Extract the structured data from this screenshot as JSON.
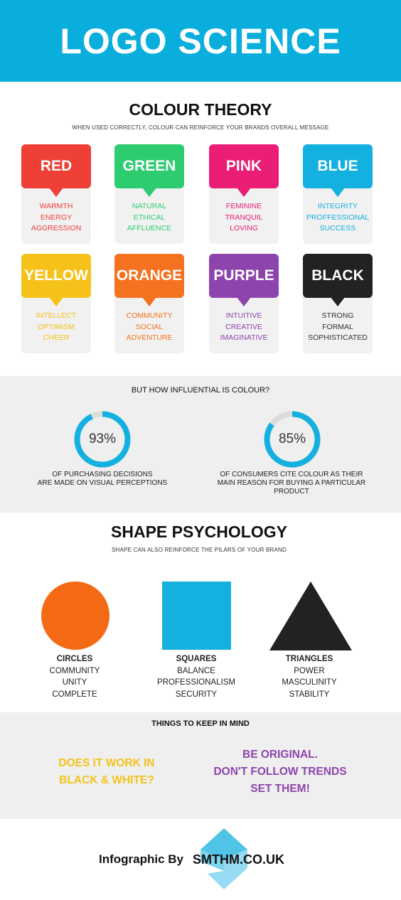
{
  "header": {
    "title": "LOGO SCIENCE"
  },
  "colour_theory": {
    "title": "COLOUR THEORY",
    "subtitle": "WHEN USED CORRECTLY, COLOUR CAN REINFORCE YOUR BRANDS OVERALL MESSAGE",
    "cards": [
      {
        "name": "RED",
        "color": "#ee4037",
        "words": [
          "WARMTH",
          "ENERGY",
          "AGGRESSION"
        ]
      },
      {
        "name": "GREEN",
        "color": "#2ecc71",
        "words": [
          "NATURAL",
          "ETHICAL",
          "AFFLUENCE"
        ]
      },
      {
        "name": "PINK",
        "color": "#e91e74",
        "words": [
          "FEMININE",
          "TRANQUIL",
          "LOVING"
        ]
      },
      {
        "name": "BLUE",
        "color": "#14b0df",
        "words": [
          "INTEGRITY",
          "PROFFESSIONAL",
          "SUCCESS"
        ]
      },
      {
        "name": "YELLOW",
        "color": "#f6c21a",
        "words": [
          "INTELLECT",
          "OPTIMISM",
          "CHEER"
        ]
      },
      {
        "name": "ORANGE",
        "color": "#f47220",
        "words": [
          "COMMUNITY",
          "SOCIAL",
          "ADVENTURE"
        ]
      },
      {
        "name": "PURPLE",
        "color": "#8e44ad",
        "words": [
          "INTUITIVE",
          "CREATIVE",
          "IMAGINATIVE"
        ]
      },
      {
        "name": "BLACK",
        "color": "#222222",
        "words": [
          "STRONG",
          "FORMAL",
          "SOPHISTICATED"
        ]
      }
    ]
  },
  "influence": {
    "title": "BUT HOW INFLUENTIAL IS COLOUR?",
    "accent": "#14b0df",
    "stats": [
      {
        "value": "93%",
        "fraction": 0.93,
        "text": [
          "OF PURCHASING DECISIONS",
          "ARE MADE ON VISUAL PERCEPTIONS"
        ]
      },
      {
        "value": "85%",
        "fraction": 0.85,
        "text": [
          "OF CONSUMERS CITE COLOUR AS THEIR",
          "MAIN REASON FOR BUYING A PARTICULAR",
          "PRODUCT"
        ]
      }
    ]
  },
  "shape_psychology": {
    "title": "SHAPE PSYCHOLOGY",
    "subtitle": "SHAPE CAN ALSO REINFORCE THE PILARS OF YOUR BRAND",
    "shapes": [
      {
        "icon": "circle-icon",
        "color": "#f46a14",
        "heading": "CIRCLES",
        "words": [
          "COMMUNITY",
          "UNITY",
          "COMPLETE"
        ]
      },
      {
        "icon": "square-icon",
        "color": "#14b0df",
        "heading": "SQUARES",
        "words": [
          "BALANCE",
          "PROFESSIONALISM",
          "SECURITY"
        ]
      },
      {
        "icon": "triangle-icon",
        "color": "#222222",
        "heading": "TRIANGLES",
        "words": [
          "POWER",
          "MASCULINITY",
          "STABILITY"
        ]
      }
    ]
  },
  "keep_in_mind": {
    "title": "THINGS TO KEEP IN MIND",
    "left": {
      "color": "#f6c21a",
      "lines": [
        "DOES IT WORK IN",
        "BLACK & WHITE?"
      ]
    },
    "right": {
      "color": "#8e44ad",
      "lines": [
        "BE ORIGINAL.",
        "DON'T FOLLOW TRENDS",
        "SET THEM!"
      ]
    }
  },
  "footer": {
    "prefix": "Infographic By",
    "brand": "SMTHM.CO.UK",
    "logo_icon": "smthm-logo-icon",
    "logo_color": "#14b0df"
  }
}
